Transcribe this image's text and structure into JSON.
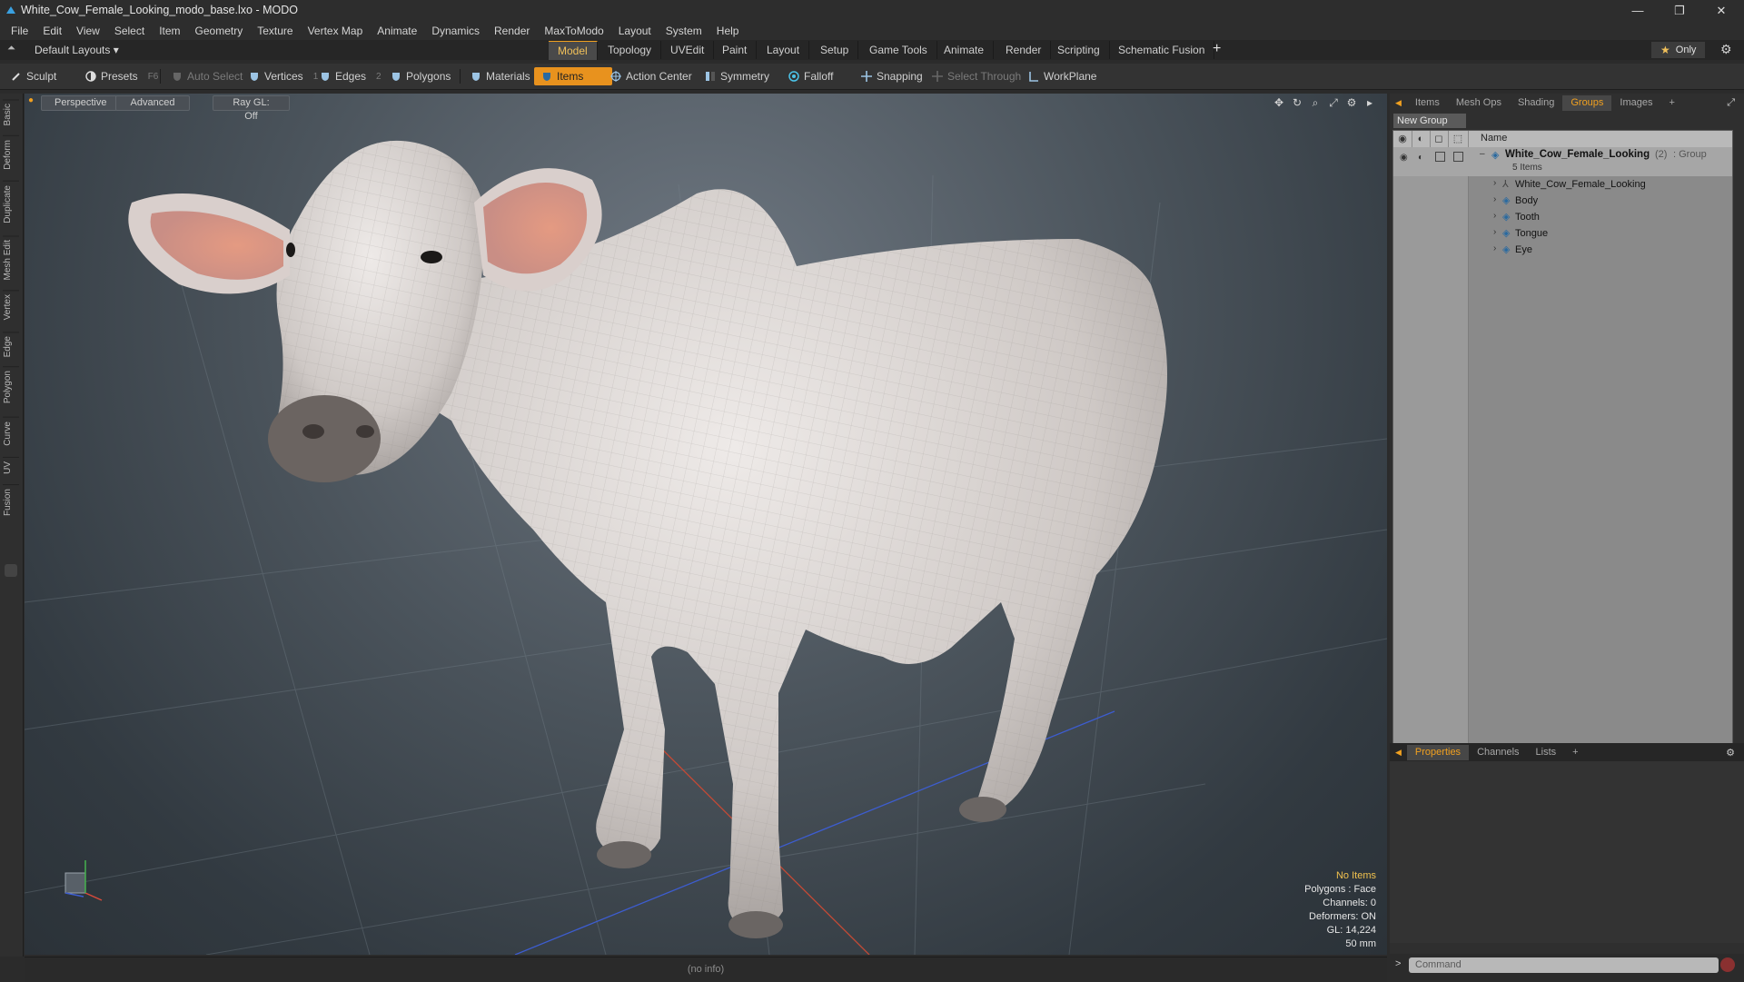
{
  "window": {
    "title": "White_Cow_Female_Looking_modo_base.lxo - MODO",
    "controls": [
      "—",
      "❐",
      "✕"
    ]
  },
  "menu": [
    "File",
    "Edit",
    "View",
    "Select",
    "Item",
    "Geometry",
    "Texture",
    "Vertex Map",
    "Animate",
    "Dynamics",
    "Render",
    "MaxToModo",
    "Layout",
    "System",
    "Help"
  ],
  "layoutbar": {
    "layouts_label": "Default Layouts ▾",
    "tabs": [
      "Model",
      "Topology",
      "UVEdit",
      "Paint",
      "Layout",
      "Setup",
      "Game Tools",
      "Animate",
      "Render",
      "Scripting",
      "Schematic Fusion"
    ],
    "active_tab": "Model",
    "add": "+",
    "only_label": "Only"
  },
  "toolbar": {
    "sculpt": "Sculpt",
    "presets": "Presets",
    "presets_key": "F6",
    "auto_select": "Auto Select",
    "vertices": "Vertices",
    "vertices_key": "1",
    "edges": "Edges",
    "edges_key": "2",
    "polygons": "Polygons",
    "materials": "Materials",
    "items": "Items",
    "action_center": "Action Center",
    "symmetry": "Symmetry",
    "falloff": "Falloff",
    "snapping": "Snapping",
    "select_through": "Select Through",
    "workplane": "WorkPlane"
  },
  "left_tabs": [
    "Basic",
    "Deform",
    "Duplicate",
    "Mesh Edit",
    "Vertex",
    "Edge",
    "Polygon",
    "Curve",
    "UV",
    "Fusion"
  ],
  "viewport": {
    "perspective": "Perspective",
    "advanced": "Advanced",
    "raygl": "Ray GL: Off",
    "info": {
      "no_items": "No Items",
      "polygons": "Polygons : Face",
      "channels": "Channels: 0",
      "deformers": "Deformers: ON",
      "gl": "GL: 14,224",
      "focal": "50 mm"
    },
    "status": "(no info)"
  },
  "right_panel": {
    "tabs": [
      "Items",
      "Mesh Ops",
      "Shading",
      "Groups",
      "Images",
      "+"
    ],
    "active_tab": "Groups",
    "new_group": "New Group",
    "col_name": "Name",
    "group": {
      "name": "White_Cow_Female_Looking",
      "count": "(2)",
      "type": ": Group",
      "sub": "5 Items"
    },
    "items": [
      "White_Cow_Female_Looking",
      "Body",
      "Tooth",
      "Tongue",
      "Eye"
    ],
    "bottom_tabs": [
      "Properties",
      "Channels",
      "Lists",
      "+"
    ],
    "bottom_active": "Properties",
    "command_placeholder": "Command"
  },
  "colors": {
    "accent": "#f0a020",
    "viewport_bg": "#4b545c",
    "panel_bg": "#8a8a8a"
  }
}
